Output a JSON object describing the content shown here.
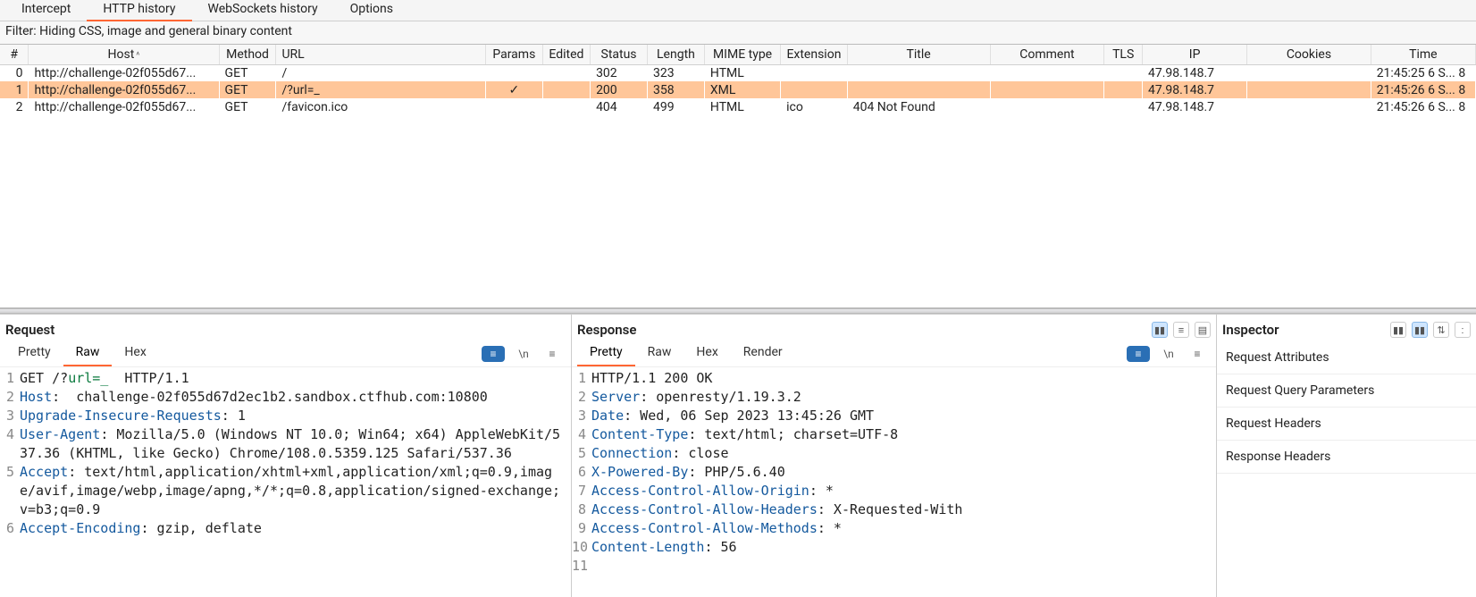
{
  "topTabs": {
    "intercept": "Intercept",
    "history": "HTTP history",
    "ws": "WebSockets history",
    "options": "Options"
  },
  "filter": {
    "label": "Filter: Hiding CSS, image and general binary content"
  },
  "table": {
    "headers": {
      "num": "#",
      "host": "Host",
      "method": "Method",
      "url": "URL",
      "params": "Params",
      "edited": "Edited",
      "status": "Status",
      "length": "Length",
      "mime": "MIME type",
      "ext": "Extension",
      "title": "Title",
      "comment": "Comment",
      "tls": "TLS",
      "ip": "IP",
      "cookies": "Cookies",
      "time": "Time"
    },
    "rows": [
      {
        "num": "0",
        "host": "http://challenge-02f055d67...",
        "method": "GET",
        "url": "/",
        "params": "",
        "status": "302",
        "length": "323",
        "mime": "HTML",
        "ext": "",
        "title": "",
        "ip": "47.98.148.7",
        "time": "21:45:25 6 S...  8"
      },
      {
        "num": "1",
        "host": "http://challenge-02f055d67...",
        "method": "GET",
        "url": "/?url=_",
        "params": "✓",
        "status": "200",
        "length": "358",
        "mime": "XML",
        "ext": "",
        "title": "",
        "ip": "47.98.148.7",
        "time": "21:45:26 6 S...  8"
      },
      {
        "num": "2",
        "host": "http://challenge-02f055d67...",
        "method": "GET",
        "url": "/favicon.ico",
        "params": "",
        "status": "404",
        "length": "499",
        "mime": "HTML",
        "ext": "ico",
        "title": "404 Not Found",
        "ip": "47.98.148.7",
        "time": "21:45:26 6 S...  8"
      }
    ]
  },
  "request": {
    "title": "Request",
    "tabs": {
      "pretty": "Pretty",
      "raw": "Raw",
      "hex": "Hex"
    },
    "lines": [
      {
        "n": "1",
        "html": "GET /?<span class='hu'>url=_</span>  HTTP/1.1"
      },
      {
        "n": "2",
        "html": "<span class='hn'>Host</span>:  challenge-02f055d67d2ec1b2.sandbox.ctfhub.com:10800"
      },
      {
        "n": "3",
        "html": "<span class='hn'>Upgrade-Insecure-Requests</span>: 1"
      },
      {
        "n": "4",
        "html": "<span class='hn'>User-Agent</span>: Mozilla/5.0 (Windows NT 10.0; Win64; x64) AppleWebKit/537.36 (KHTML, like Gecko) Chrome/108.0.5359.125 Safari/537.36"
      },
      {
        "n": "5",
        "html": "<span class='hn'>Accept</span>: text/html,application/xhtml+xml,application/xml;q=0.9,image/avif,image/webp,image/apng,*/*;q=0.8,application/signed-exchange;v=b3;q=0.9"
      },
      {
        "n": "6",
        "html": "<span class='hn'>Accept-Encoding</span>: gzip, deflate"
      }
    ]
  },
  "response": {
    "title": "Response",
    "tabs": {
      "pretty": "Pretty",
      "raw": "Raw",
      "hex": "Hex",
      "render": "Render"
    },
    "lines": [
      {
        "n": "1",
        "html": "HTTP/1.1 200 OK"
      },
      {
        "n": "2",
        "html": "<span class='hn'>Server</span>: openresty/1.19.3.2"
      },
      {
        "n": "3",
        "html": "<span class='hn'>Date</span>: Wed, 06 Sep 2023 13:45:26 GMT"
      },
      {
        "n": "4",
        "html": "<span class='hn'>Content-Type</span>: text/html; charset=UTF-8"
      },
      {
        "n": "5",
        "html": "<span class='hn'>Connection</span>: close"
      },
      {
        "n": "6",
        "html": "<span class='hn'>X-Powered-By</span>: PHP/5.6.40"
      },
      {
        "n": "7",
        "html": "<span class='hn'>Access-Control-Allow-Origin</span>: *"
      },
      {
        "n": "8",
        "html": "<span class='hn'>Access-Control-Allow-Headers</span>: X-Requested-With"
      },
      {
        "n": "9",
        "html": "<span class='hn'>Access-Control-Allow-Methods</span>: *"
      },
      {
        "n": "10",
        "html": "<span class='hn'>Content-Length</span>: 56"
      },
      {
        "n": "11",
        "html": ""
      }
    ]
  },
  "inspector": {
    "title": "Inspector",
    "sections": {
      "attrs": "Request Attributes",
      "query": "Request Query Parameters",
      "reqh": "Request Headers",
      "resh": "Response Headers"
    }
  },
  "glyphs": {
    "newline": "\\n",
    "menu": "≡",
    "sort": "^",
    "layout1": "▮▮",
    "layout2": "≡",
    "layout3": "▤",
    "cfg": "⚙"
  }
}
